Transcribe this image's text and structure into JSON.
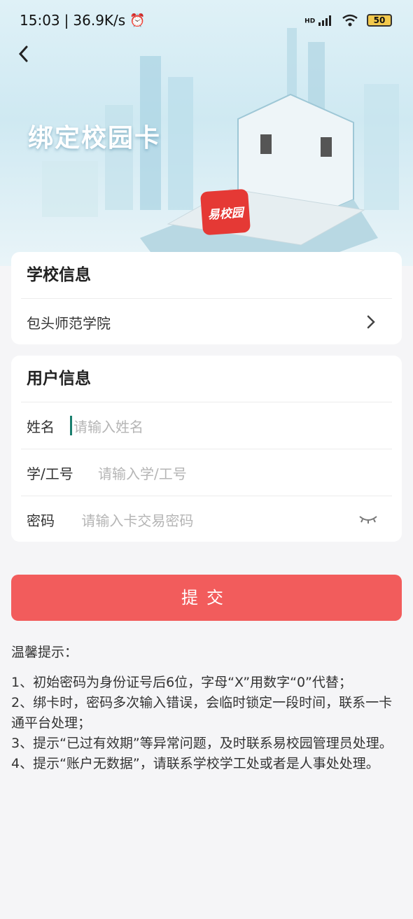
{
  "status": {
    "time": "15:03",
    "speed": "36.9K/s",
    "network": "HD",
    "battery": "50"
  },
  "hero": {
    "title": "绑定校园卡",
    "app_logo_text": "易校园"
  },
  "school_card": {
    "title": "学校信息",
    "school_name": "包头师范学院"
  },
  "user_card": {
    "title": "用户信息",
    "name_label": "姓名",
    "name_placeholder": "请输入姓名",
    "id_label": "学/工号",
    "id_placeholder": "请输入学/工号",
    "pwd_label": "密码",
    "pwd_placeholder": "请输入卡交易密码"
  },
  "submit_label": "提交",
  "tips": {
    "title": "温馨提示：",
    "items": [
      "1、初始密码为身份证号后6位，字母“X”用数字“0”代替；",
      "2、绑卡时，密码多次输入错误，会临时锁定一段时间，联系一卡通平台处理；",
      "3、提示“已过有效期”等异常问题，及时联系易校园管理员处理。",
      "4、提示“账户无数据”，请联系学校学工处或者是人事处处理。"
    ]
  }
}
